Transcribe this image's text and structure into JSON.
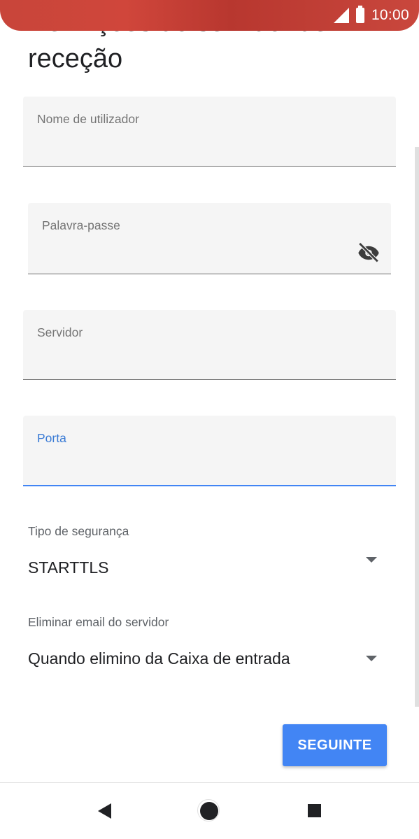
{
  "status_bar": {
    "time": "10:00",
    "icons": [
      "signal-icon",
      "battery-icon"
    ],
    "color": "#c8453a"
  },
  "page": {
    "title": "Definições do servidor de receção"
  },
  "form": {
    "username": {
      "label": "Nome de utilizador",
      "value": ""
    },
    "password": {
      "label": "Palavra-passe",
      "value": "",
      "toggle_icon": "eye-off-icon"
    },
    "server": {
      "label": "Servidor",
      "value": ""
    },
    "port": {
      "label": "Porta",
      "value": "",
      "focused": true
    },
    "security_type": {
      "label": "Tipo de segurança",
      "value": "STARTTLS"
    },
    "delete_email": {
      "label": "Eliminar email do servidor",
      "value": "Quando elimino da Caixa de entrada"
    }
  },
  "actions": {
    "next_label": "SEGUINTE",
    "accent_color": "#4285f4"
  },
  "nav_bar": {
    "icons": [
      "back-icon",
      "home-icon",
      "recents-icon"
    ]
  }
}
